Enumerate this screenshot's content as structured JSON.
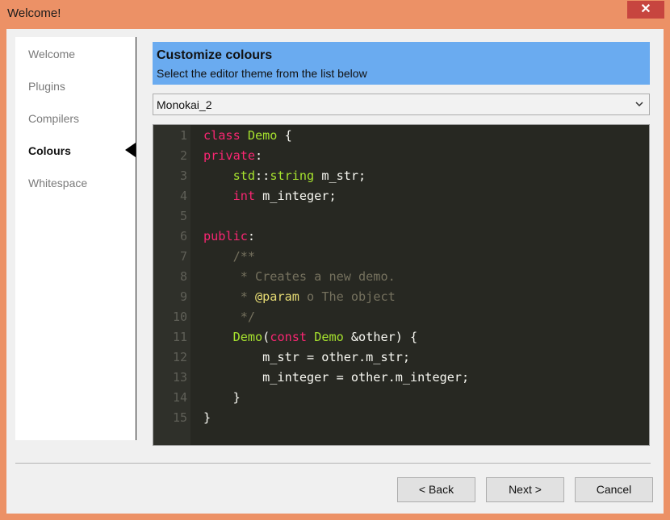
{
  "window": {
    "title": "Welcome!",
    "close_label": "✕"
  },
  "sidebar": {
    "items": [
      {
        "label": "Welcome"
      },
      {
        "label": "Plugins"
      },
      {
        "label": "Compilers"
      },
      {
        "label": "Colours",
        "active": true
      },
      {
        "label": "Whitespace"
      }
    ]
  },
  "header": {
    "title": "Customize colours",
    "subtitle": "Select the editor theme from the list below"
  },
  "theme_select": {
    "value": "Monokai_2"
  },
  "editor": {
    "line_numbers": [
      "1",
      "2",
      "3",
      "4",
      "5",
      "6",
      "7",
      "8",
      "9",
      "10",
      "11",
      "12",
      "13",
      "14",
      "15"
    ],
    "lines": [
      [
        {
          "t": "class ",
          "c": "kw"
        },
        {
          "t": "Demo",
          "c": "ty"
        },
        {
          "t": " {"
        }
      ],
      [
        {
          "t": "private",
          "c": "kw"
        },
        {
          "t": ":"
        }
      ],
      [
        {
          "t": "    "
        },
        {
          "t": "std",
          "c": "ty"
        },
        {
          "t": "::"
        },
        {
          "t": "string",
          "c": "ty"
        },
        {
          "t": " m_str;"
        }
      ],
      [
        {
          "t": "    "
        },
        {
          "t": "int",
          "c": "kw"
        },
        {
          "t": " m_integer;"
        }
      ],
      [],
      [
        {
          "t": "public",
          "c": "kw"
        },
        {
          "t": ":"
        }
      ],
      [
        {
          "t": "    /**",
          "c": "cm"
        }
      ],
      [
        {
          "t": "     * Creates a new demo.",
          "c": "cm"
        }
      ],
      [
        {
          "t": "     * ",
          "c": "cm"
        },
        {
          "t": "@param",
          "c": "an"
        },
        {
          "t": " o The object",
          "c": "cm"
        }
      ],
      [
        {
          "t": "     */",
          "c": "cm"
        }
      ],
      [
        {
          "t": "    "
        },
        {
          "t": "Demo",
          "c": "ty"
        },
        {
          "t": "("
        },
        {
          "t": "const",
          "c": "kw"
        },
        {
          "t": " "
        },
        {
          "t": "Demo",
          "c": "ty"
        },
        {
          "t": " &other) {"
        }
      ],
      [
        {
          "t": "        m_str = other.m_str;"
        }
      ],
      [
        {
          "t": "        m_integer = other.m_integer;"
        }
      ],
      [
        {
          "t": "    }"
        }
      ],
      [
        {
          "t": "}"
        }
      ]
    ]
  },
  "footer": {
    "back_label": "< Back",
    "next_label": "Next >",
    "cancel_label": "Cancel"
  }
}
